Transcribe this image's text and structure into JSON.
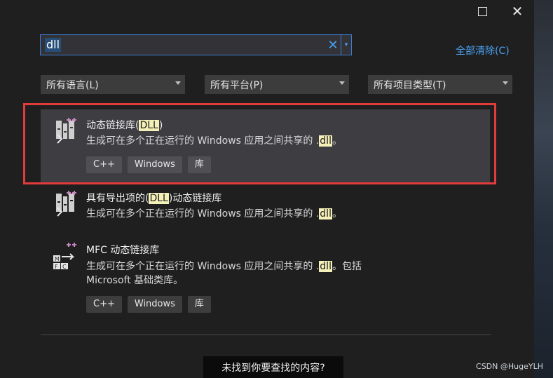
{
  "window": {
    "maximize_icon": "maximize-icon",
    "close_icon": "close-icon",
    "close_glyph": "✕"
  },
  "search": {
    "value": "dll",
    "clear_glyph": "✕",
    "dropdown_glyph": "▾"
  },
  "clear_all": "全部清除(C)",
  "filters": {
    "language": "所有语言(L)",
    "platform": "所有平台(P)",
    "project_type": "所有项目类型(T)"
  },
  "templates": [
    {
      "title_pre": "动态链接库(",
      "title_hl": "DLL",
      "title_post": ")",
      "desc_pre": "生成可在多个正在运行的 Windows 应用之间共享的 .",
      "desc_hl": "dll",
      "desc_post": "。",
      "tags": [
        "C++",
        "Windows",
        "库"
      ],
      "icon": "dll-project-icon",
      "selected": true
    },
    {
      "title_pre": "具有导出项的(",
      "title_hl": "DLL",
      "title_post": ")动态链接库",
      "desc_pre": "生成可在多个正在运行的 Windows 应用之间共享的 .",
      "desc_hl": "dll",
      "desc_post": "。",
      "icon": "dll-exports-project-icon"
    },
    {
      "title_pre": "MFC 动态链接库",
      "desc_pre": "生成可在多个正在运行的 Windows 应用之间共享的 .",
      "desc_hl": "dll",
      "desc_post": "。包括",
      "desc_line2": "Microsoft 基础类库。",
      "tags": [
        "C++",
        "Windows",
        "库"
      ],
      "icon": "mfc-dll-project-icon"
    }
  ],
  "not_found_link": "未找到你要查找的内容?",
  "watermark": "CSDN @HugeYLH",
  "colors": {
    "accent": "#4aa3f5",
    "highlight_frame": "#e23b3b",
    "match_highlight": "#f4f0b8"
  }
}
